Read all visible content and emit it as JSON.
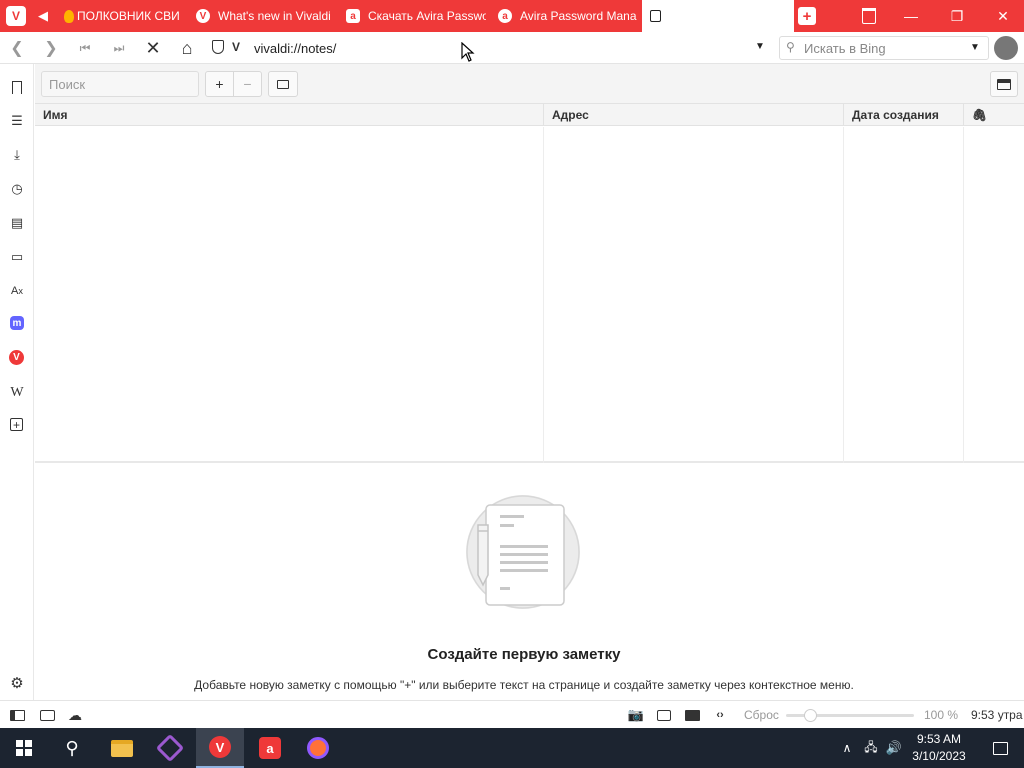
{
  "tabs": [
    {
      "title": "ПОЛКОВНИК СВИ",
      "icon": "fire-icon"
    },
    {
      "title": "What's new in Vivaldi",
      "icon": "vivaldi-icon"
    },
    {
      "title": "Скачать Avira Passwo",
      "icon": "avira-icon"
    },
    {
      "title": "Avira Password Mana",
      "icon": "avira-icon"
    },
    {
      "title": "",
      "icon": "notes-icon"
    }
  ],
  "address": {
    "url": "vivaldi://notes/",
    "search_placeholder": "Искать в Bing"
  },
  "notes": {
    "search_placeholder": "Поиск",
    "add_label": "+",
    "remove_label": "−",
    "columns": [
      "Имя",
      "Адрес",
      "Дата создания"
    ],
    "empty_title": "Создайте первую заметку",
    "empty_desc": "Добавьте новую заметку с помощью \"+\" или выберите текст на странице и создайте заметку через контекстное меню."
  },
  "statusbar": {
    "reset_label": "Сброс",
    "zoom": "100 %",
    "time": "9:53 утра"
  },
  "taskbar": {
    "time": "9:53 AM",
    "date": "3/10/2023"
  },
  "colors": {
    "accent": "#ef3939",
    "taskbar": "#1c2430"
  }
}
